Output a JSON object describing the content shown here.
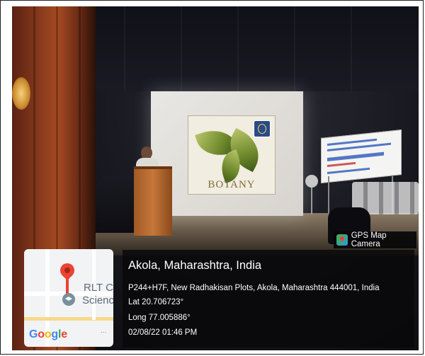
{
  "overlay": {
    "badge_label": "GPS Map Camera",
    "location_title": "Akola, Maharashtra, India",
    "address": "P244+H7F, New Radhakisan Plots, Akola, Maharashtra 444001, India",
    "latitude": "Lat 20.706723°",
    "longitude": "Long 77.005886°",
    "timestamp": "02/08/22 01:46 PM"
  },
  "map": {
    "label_line1": "RLT Co",
    "label_line2": "Scienc",
    "logo_g1": "G",
    "logo_o1": "o",
    "logo_o2": "o",
    "logo_g2": "g",
    "logo_l": "l",
    "logo_e": "e",
    "more": "..."
  },
  "scene": {
    "slide_word": "BOTANY"
  },
  "colors": {
    "overlay_bg": "#08080a",
    "pin_red": "#ea4335",
    "curtain": "#a54a22"
  },
  "icons": {
    "badge": "gps-map-camera-icon",
    "map_pin": "map-pin-icon",
    "place": "graduation-cap-icon"
  }
}
